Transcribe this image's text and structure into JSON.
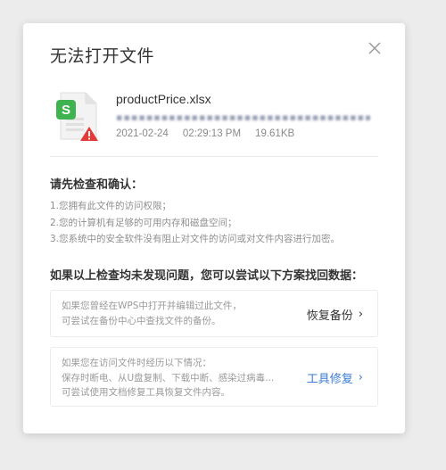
{
  "dialog": {
    "title": "无法打开文件",
    "file": {
      "name": "productPrice.xlsx",
      "date": "2021-02-24",
      "time": "02:29:13 PM",
      "size": "19.61KB",
      "app_badge": "S"
    },
    "check_title": "请先检查和确认：",
    "checks": [
      "1.您拥有此文件的访问权限；",
      "2.您的计算机有足够的可用内存和磁盘空间；",
      "3.您系统中的安全软件没有阻止对文件的访问或对文件内容进行加密。"
    ],
    "recover_title": "如果以上检查均未发现问题，您可以尝试以下方案找回数据：",
    "option1": {
      "lines": [
        "如果您曾经在WPS中打开并编辑过此文件，",
        "可尝试在备份中心中查找文件的备份。"
      ],
      "action": "恢复备份",
      "action_color": "#333333"
    },
    "option2": {
      "lines": [
        "如果您在访问文件时经历以下情况：",
        "保存时断电、从U盘复制、下载中断、感染过病毒...",
        "可尝试使用文档修复工具恢复文件内容。"
      ],
      "action": "工具修复",
      "action_color": "#3a7bd5"
    }
  },
  "colors": {
    "spreadsheet_green": "#3fb34f",
    "warning_red": "#e53935",
    "link_blue": "#3a7bd5"
  }
}
